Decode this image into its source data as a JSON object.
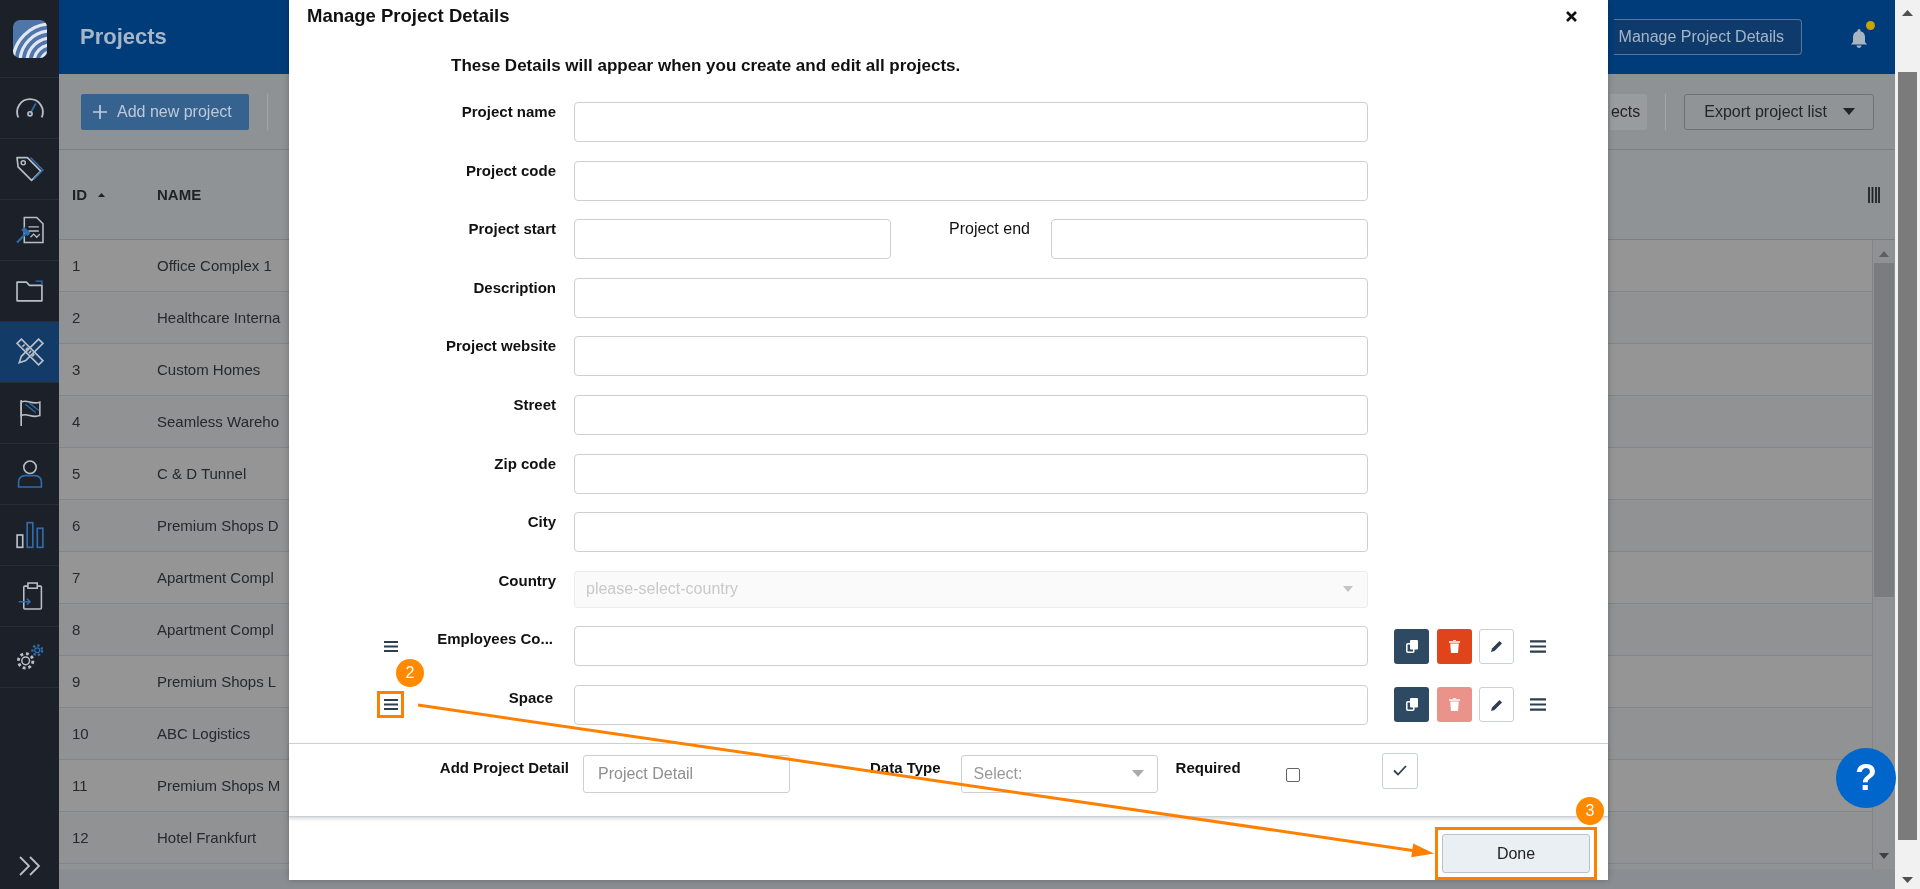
{
  "sidebar": {
    "items": [
      {
        "selected": false
      },
      {
        "selected": false
      },
      {
        "selected": false
      },
      {
        "selected": false
      },
      {
        "selected": true
      },
      {
        "selected": false
      },
      {
        "selected": false
      },
      {
        "selected": false
      },
      {
        "selected": false
      },
      {
        "selected": false
      }
    ]
  },
  "header": {
    "title": "Projects",
    "manage_button": "Manage Project Details",
    "unread_notifications": true
  },
  "toolbar": {
    "add_button": "Add new project",
    "partial_button": "ects",
    "export_button": "Export project list"
  },
  "table": {
    "columns": [
      {
        "label": "ID",
        "sorted_ascending": true
      },
      {
        "label": "NAME",
        "sorted_ascending": false
      }
    ],
    "rows": [
      {
        "id": "1",
        "name": "Office Complex 1"
      },
      {
        "id": "2",
        "name": "Healthcare Interna"
      },
      {
        "id": "3",
        "name": "Custom Homes"
      },
      {
        "id": "4",
        "name": "Seamless Wareho"
      },
      {
        "id": "5",
        "name": "C & D Tunnel"
      },
      {
        "id": "6",
        "name": "Premium Shops D"
      },
      {
        "id": "7",
        "name": "Apartment Compl"
      },
      {
        "id": "8",
        "name": "Apartment Compl"
      },
      {
        "id": "9",
        "name": "Premium Shops L"
      },
      {
        "id": "10",
        "name": "ABC Logistics"
      },
      {
        "id": "11",
        "name": "Premium Shops M"
      },
      {
        "id": "12",
        "name": "Hotel Frankfurt"
      }
    ]
  },
  "dialog": {
    "title": "Manage Project Details",
    "intro": "These Details will appear when you create and edit all projects.",
    "fields": [
      {
        "kind": "text",
        "label": "Project name"
      },
      {
        "kind": "text",
        "label": "Project code"
      },
      {
        "kind": "range",
        "label": "Project start",
        "end_label": "Project end"
      },
      {
        "kind": "text",
        "label": "Description"
      },
      {
        "kind": "text",
        "label": "Project website"
      },
      {
        "kind": "text",
        "label": "Street"
      },
      {
        "kind": "text",
        "label": "Zip code"
      },
      {
        "kind": "text",
        "label": "City"
      },
      {
        "kind": "select",
        "label": "Country",
        "placeholder": "please-select-country",
        "disabled": true
      },
      {
        "kind": "custom",
        "label": "Employees Co...",
        "delete_disabled": false
      },
      {
        "kind": "custom",
        "label": "Space",
        "delete_disabled": true,
        "callout": "2"
      }
    ],
    "add_detail": {
      "label": "Add Project Detail",
      "placeholder": "Project Detail",
      "type_label": "Data Type",
      "type_select": "Select:",
      "required_label": "Required",
      "required": false
    },
    "done_button": {
      "label": "Done",
      "callout": "3"
    }
  },
  "help_button": "?"
}
